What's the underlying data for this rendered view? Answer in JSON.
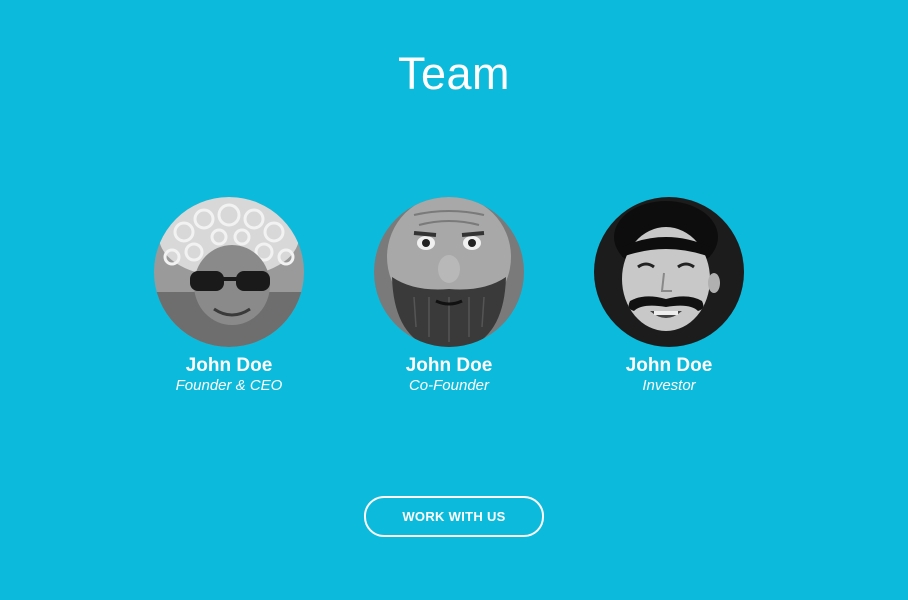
{
  "section": {
    "title": "Team"
  },
  "members": [
    {
      "name": "John Doe",
      "role": "Founder & CEO"
    },
    {
      "name": "John Doe",
      "role": "Co-Founder"
    },
    {
      "name": "John Doe",
      "role": "Investor"
    }
  ],
  "cta": {
    "label": "WORK WITH US"
  },
  "colors": {
    "background": "#0cbbdc",
    "text": "#ffffff"
  }
}
